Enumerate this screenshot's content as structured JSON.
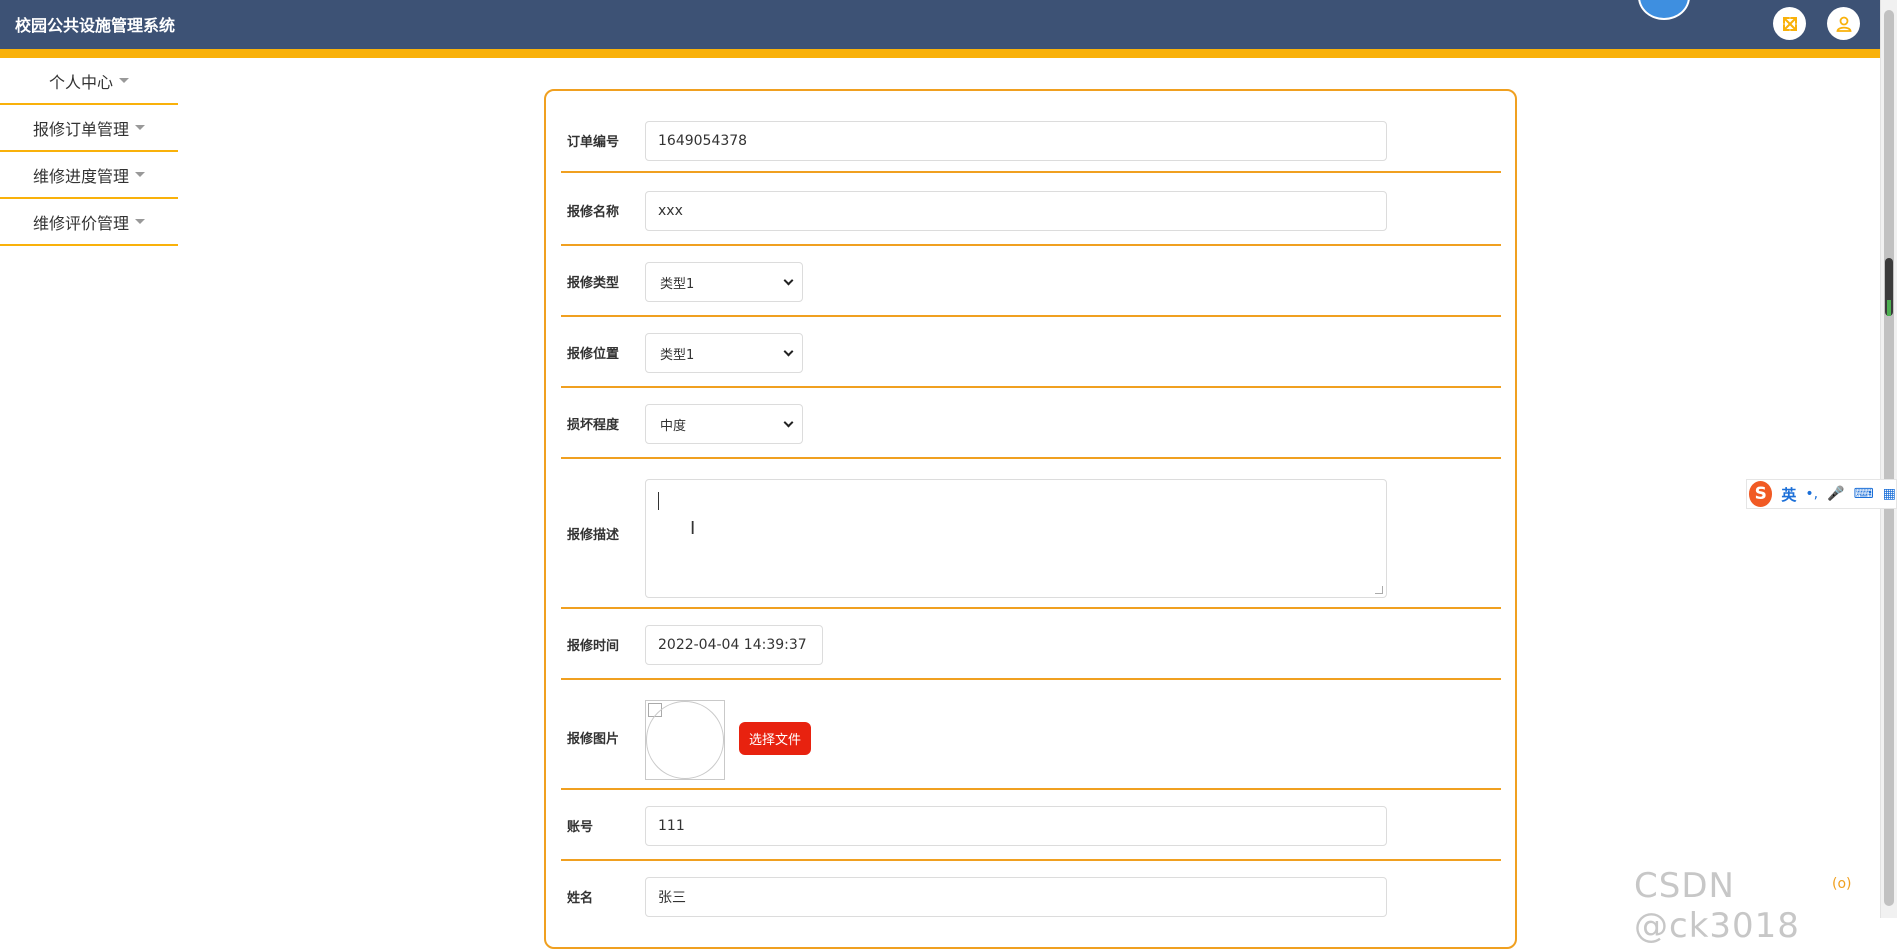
{
  "header": {
    "app_title": "校园公共设施管理系统"
  },
  "sidebar": {
    "items": [
      {
        "label": "个人中心"
      },
      {
        "label": "报修订单管理"
      },
      {
        "label": "维修进度管理"
      },
      {
        "label": "维修评价管理"
      }
    ]
  },
  "form": {
    "order_no": {
      "label": "订单编号",
      "value": "1649054378"
    },
    "repair_name": {
      "label": "报修名称",
      "value": "xxx"
    },
    "repair_type": {
      "label": "报修类型",
      "value": "类型1"
    },
    "repair_location": {
      "label": "报修位置",
      "value": "类型1"
    },
    "damage_level": {
      "label": "损坏程度",
      "value": "中度"
    },
    "description": {
      "label": "报修描述",
      "value": ""
    },
    "repair_time": {
      "label": "报修时间",
      "value": "2022-04-04 14:39:37"
    },
    "repair_image": {
      "label": "报修图片",
      "button": "选择文件"
    },
    "account": {
      "label": "账号",
      "value": "111"
    },
    "name": {
      "label": "姓名",
      "value": "张三"
    }
  },
  "ime": {
    "logo": "S",
    "lang": "英",
    "punct": "•,",
    "mic": "🎤",
    "keyboard": "⌨",
    "grid": "▦"
  },
  "watermark": "CSDN @ck3018",
  "float_dots": "(o)",
  "colors": {
    "header_bg": "#3d5275",
    "accent": "#f9b10a",
    "panel_border": "#f0a020",
    "file_button": "#e8220f"
  },
  "icons": {
    "fullscreen": "expand-arrows-icon",
    "user": "user-icon"
  }
}
